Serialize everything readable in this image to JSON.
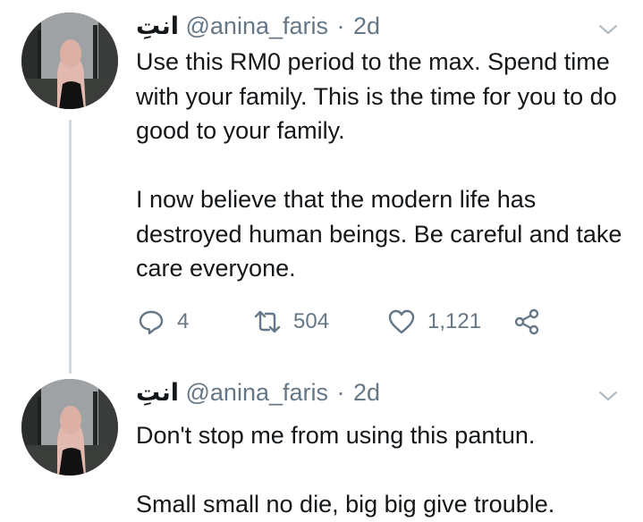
{
  "tweets": [
    {
      "display_name": "انتِ",
      "handle": "@anina_faris",
      "separator": "·",
      "time": "2d",
      "text": "Use this RM0 period to the max. Spend time with your family. This is the time for you to do good to your family.\n\nI now believe that the modern life has destroyed human beings. Be careful and take care everyone.",
      "replies": "4",
      "retweets": "504",
      "likes": "1,121"
    },
    {
      "display_name": "انتِ",
      "handle": "@anina_faris",
      "separator": "·",
      "time": "2d",
      "text": "Don't stop me from using this pantun.\n\nSmall small no die, big big give trouble."
    }
  ],
  "icons": {
    "reply": "reply-icon",
    "retweet": "retweet-icon",
    "like": "heart-icon",
    "share": "share-icon",
    "menu": "chevron-down-icon"
  },
  "colors": {
    "text": "#14171a",
    "secondary": "#657786",
    "thread_line": "#cfd9de"
  }
}
